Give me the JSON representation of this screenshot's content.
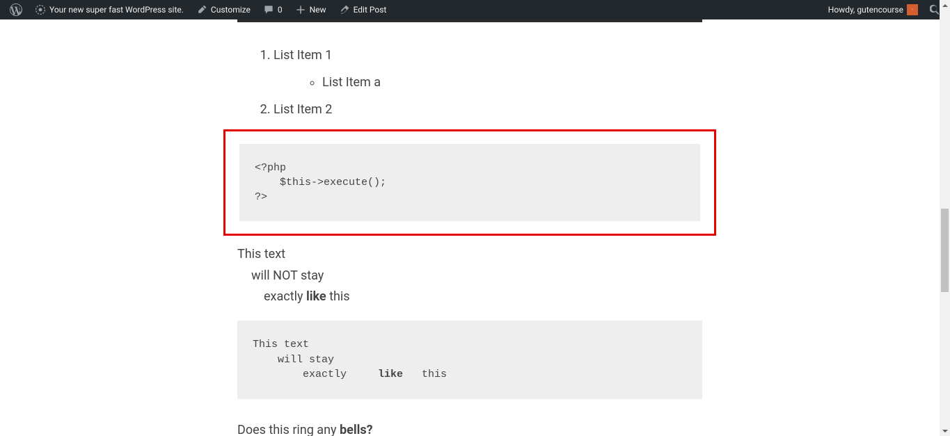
{
  "adminbar": {
    "site_name": "Your new super fast WordPress site.",
    "customize": "Customize",
    "comments_count": "0",
    "new": "New",
    "edit_post": "Edit Post",
    "howdy_prefix": "Howdy, ",
    "username": "gutencourse"
  },
  "content": {
    "list": {
      "item1": "List Item 1",
      "item1a": "List Item a",
      "item2": "List Item 2"
    },
    "code_block": "<?php\n    $this->execute();\n?>",
    "paragraph": {
      "line1": "This text",
      "line2_pre": "will NOT stay",
      "line3_pre": "exactly     ",
      "line3_bold": "like",
      "line3_post": " this"
    },
    "preformatted": {
      "line1": "This text",
      "line2": "    will stay",
      "line3_pre": "        exactly     ",
      "line3_bold": "like",
      "line3_post": "   this"
    },
    "bells": {
      "pre": "Does this ring any ",
      "bold": "bells?"
    }
  }
}
